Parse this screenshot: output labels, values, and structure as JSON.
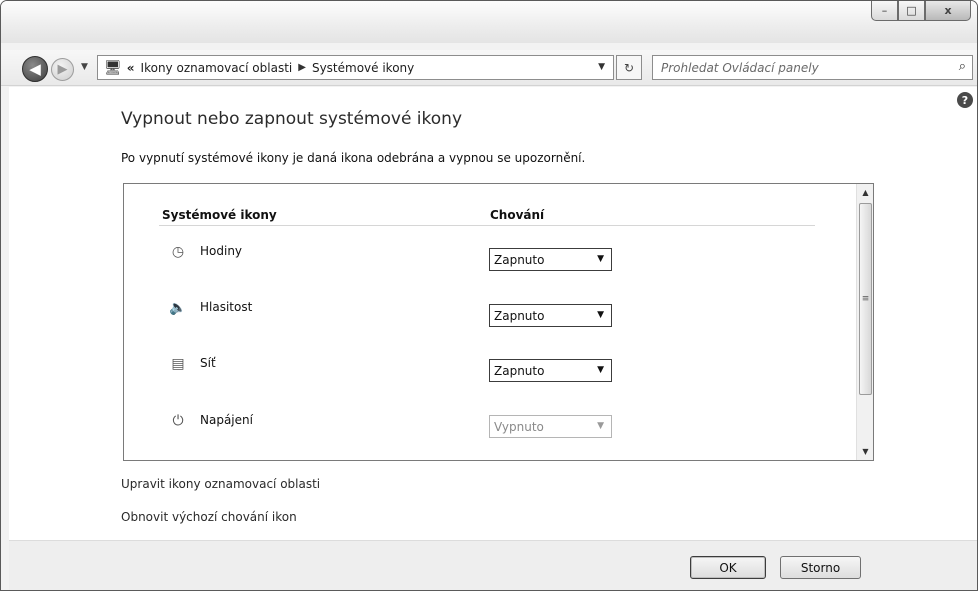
{
  "window": {
    "controls": {
      "minimize": "–",
      "maximize": "□",
      "close": "x"
    }
  },
  "toolbar": {
    "back_icon": "arrow-left-icon",
    "forward_icon": "arrow-right-icon",
    "breadcrumb": {
      "overflow": "«",
      "items": [
        "Ikony oznamovací oblasti",
        "Systémové ikony"
      ],
      "separator": "▶"
    },
    "search_placeholder": "Prohledat Ovládací panely"
  },
  "main": {
    "title": "Vypnout nebo zapnout systémové ikony",
    "description": "Po vypnutí systémové ikony je daná ikona odebrána a vypnou se upozornění.",
    "table": {
      "columns": [
        "Systémové ikony",
        "Chování"
      ],
      "rows": [
        {
          "label": "Hodiny",
          "icon": "clock-icon",
          "value": "Zapnuto",
          "enabled": true
        },
        {
          "label": "Hlasitost",
          "icon": "speaker-icon",
          "value": "Zapnuto",
          "enabled": true
        },
        {
          "label": "Síť",
          "icon": "network-icon",
          "value": "Zapnuto",
          "enabled": true
        },
        {
          "label": "Napájení",
          "icon": "power-icon",
          "value": "Vypnuto",
          "enabled": false
        }
      ]
    },
    "links": {
      "customize": "Upravit ikony oznamovací oblasti",
      "restore": "Obnovit výchozí chování ikon"
    }
  },
  "footer": {
    "ok_label": "OK",
    "cancel_label": "Storno"
  }
}
